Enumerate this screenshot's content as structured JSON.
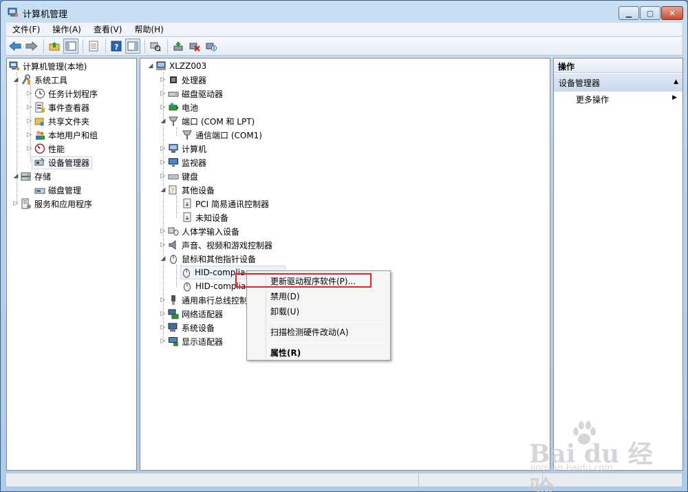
{
  "window": {
    "title": "计算机管理"
  },
  "menu": [
    "文件(F)",
    "操作(A)",
    "查看(V)",
    "帮助(H)"
  ],
  "left_tree": [
    {
      "label": "计算机管理(本地)",
      "icon": "computer-management-icon"
    },
    {
      "label": "系统工具",
      "icon": "system-tools-icon"
    },
    {
      "label": "任务计划程序",
      "icon": "task-scheduler-icon"
    },
    {
      "label": "事件查看器",
      "icon": "event-viewer-icon"
    },
    {
      "label": "共享文件夹",
      "icon": "shared-folders-icon"
    },
    {
      "label": "本地用户和组",
      "icon": "local-users-icon"
    },
    {
      "label": "性能",
      "icon": "performance-icon"
    },
    {
      "label": "设备管理器",
      "icon": "device-manager-icon"
    },
    {
      "label": "存储",
      "icon": "storage-icon"
    },
    {
      "label": "磁盘管理",
      "icon": "disk-management-icon"
    },
    {
      "label": "服务和应用程序",
      "icon": "services-icon"
    }
  ],
  "device_tree": [
    {
      "label": "XLZZ003",
      "icon": "computer-icon"
    },
    {
      "label": "处理器",
      "icon": "processor-icon"
    },
    {
      "label": "磁盘驱动器",
      "icon": "disk-drive-icon"
    },
    {
      "label": "电池",
      "icon": "battery-icon"
    },
    {
      "label": "端口 (COM 和 LPT)",
      "icon": "port-icon"
    },
    {
      "label": "通信端口 (COM1)",
      "icon": "port-device-icon"
    },
    {
      "label": "计算机",
      "icon": "computer-icon"
    },
    {
      "label": "监视器",
      "icon": "monitor-icon"
    },
    {
      "label": "键盘",
      "icon": "keyboard-icon"
    },
    {
      "label": "其他设备",
      "icon": "other-devices-icon"
    },
    {
      "label": "PCI 简易通讯控制器",
      "icon": "unknown-device-icon"
    },
    {
      "label": "未知设备",
      "icon": "unknown-device-icon"
    },
    {
      "label": "人体学输入设备",
      "icon": "hid-icon"
    },
    {
      "label": "声音、视频和游戏控制器",
      "icon": "sound-icon"
    },
    {
      "label": "鼠标和其他指针设备",
      "icon": "mouse-icon"
    },
    {
      "label": "HID-complia",
      "icon": "mouse-icon"
    },
    {
      "label": "HID-complia",
      "icon": "mouse-icon"
    },
    {
      "label": "通用串行总线控制",
      "icon": "usb-icon"
    },
    {
      "label": "网络适配器",
      "icon": "network-icon"
    },
    {
      "label": "系统设备",
      "icon": "system-device-icon"
    },
    {
      "label": "显示适配器",
      "icon": "display-adapter-icon"
    }
  ],
  "actions": {
    "header": "操作",
    "section": "设备管理器",
    "more": "更多操作"
  },
  "context_menu": [
    "更新驱动程序软件(P)...",
    "禁用(D)",
    "卸载(U)",
    "扫描检测硬件改动(A)",
    "属性(R)"
  ],
  "watermark": {
    "main": "Bai du 经验",
    "sub": "jingyan.baidu.com"
  },
  "colors": {
    "highlight": "#e3232c",
    "title_bg": "#b7d1ec"
  }
}
